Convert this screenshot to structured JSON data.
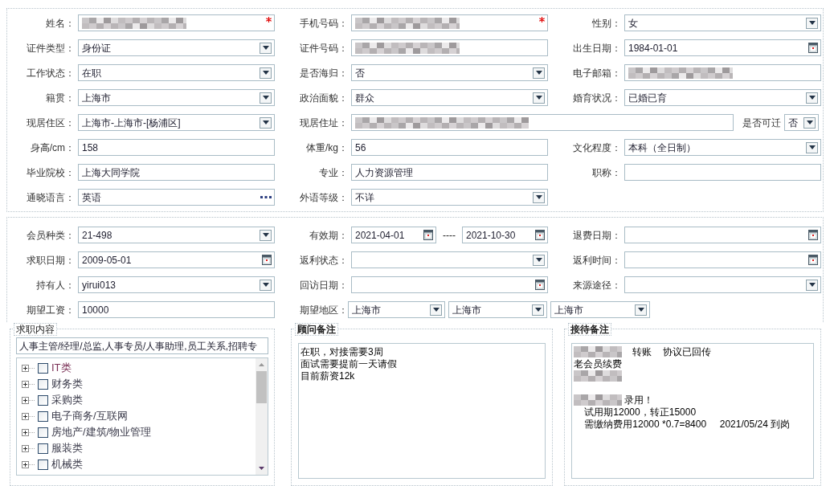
{
  "personal_section": {
    "rows": [
      [
        {
          "label": "姓名：",
          "field": {
            "kind": "text",
            "redacted": true,
            "required": true
          }
        },
        {
          "label": "手机号码：",
          "field": {
            "kind": "text",
            "redacted": true,
            "required": true
          }
        },
        {
          "label": "性别：",
          "field": {
            "kind": "select",
            "value": "女"
          }
        }
      ],
      [
        {
          "label": "证件类型：",
          "field": {
            "kind": "select",
            "value": "身份证"
          }
        },
        {
          "label": "证件号码：",
          "field": {
            "kind": "text",
            "redacted": true
          }
        },
        {
          "label": "出生日期：",
          "field": {
            "kind": "date",
            "value": "1984-01-01"
          }
        }
      ],
      [
        {
          "label": "工作状态：",
          "field": {
            "kind": "select",
            "value": "在职"
          }
        },
        {
          "label": "是否海归：",
          "field": {
            "kind": "select",
            "value": "否"
          }
        },
        {
          "label": "电子邮箱：",
          "field": {
            "kind": "text",
            "redacted": true
          }
        }
      ],
      [
        {
          "label": "籍贯：",
          "field": {
            "kind": "select",
            "value": "上海市"
          }
        },
        {
          "label": "政治面貌：",
          "field": {
            "kind": "select",
            "value": "群众"
          }
        },
        {
          "label": "婚育状况：",
          "field": {
            "kind": "select",
            "value": "已婚已育"
          }
        }
      ],
      [
        {
          "label": "现居住区：",
          "field": {
            "kind": "select",
            "value": "上海市-上海市-[杨浦区]"
          }
        },
        {
          "label": "现居住址：",
          "field": {
            "kind": "text",
            "redacted": true
          },
          "extra": {
            "label": "是否可迁",
            "field": {
              "kind": "select",
              "value": "否"
            }
          }
        }
      ],
      [
        {
          "label": "身高/cm：",
          "field": {
            "kind": "text",
            "value": "158"
          }
        },
        {
          "label": "体重/kg：",
          "field": {
            "kind": "text",
            "value": "56"
          }
        },
        {
          "label": "文化程度：",
          "field": {
            "kind": "select",
            "value": "本科（全日制）"
          }
        }
      ],
      [
        {
          "label": "毕业院校：",
          "field": {
            "kind": "text",
            "value": "上海大同学院"
          }
        },
        {
          "label": "专业：",
          "field": {
            "kind": "text",
            "value": "人力资源管理"
          }
        },
        {
          "label": "职称：",
          "field": {
            "kind": "text"
          }
        }
      ],
      [
        {
          "label": "通晓语言：",
          "field": {
            "kind": "lookup",
            "value": "英语"
          }
        },
        {
          "label": "外语等级：",
          "field": {
            "kind": "select",
            "value": "不详"
          }
        }
      ]
    ]
  },
  "membership_section": {
    "rows": [
      [
        {
          "label": "会员种类：",
          "field": {
            "kind": "select",
            "value": "21-498"
          }
        },
        {
          "label": "有效期：",
          "field": {
            "kind": "date_range",
            "values": [
              "2021-04-01",
              "2021-10-30"
            ],
            "separator": "----"
          }
        },
        {
          "label": "退费日期：",
          "field": {
            "kind": "date"
          }
        }
      ],
      [
        {
          "label": "求职日期：",
          "field": {
            "kind": "date",
            "value": "2009-05-01"
          }
        },
        {
          "label": "返利状态：",
          "field": {
            "kind": "select"
          }
        },
        {
          "label": "返利时间：",
          "field": {
            "kind": "date"
          }
        }
      ],
      [
        {
          "label": "持有人：",
          "field": {
            "kind": "select",
            "value": "yirui013"
          }
        },
        {
          "label": "回访日期：",
          "field": {
            "kind": "date"
          }
        },
        {
          "label": "来源途径：",
          "field": {
            "kind": "select"
          }
        }
      ],
      [
        {
          "label": "期望工资：",
          "field": {
            "kind": "text",
            "value": "10000"
          }
        },
        {
          "label": "期望地区：",
          "field": {
            "kind": "select_group",
            "values": [
              "上海市",
              "上海市",
              "上海市"
            ]
          }
        }
      ]
    ]
  },
  "job_content": {
    "title": "求职内容",
    "summary": "人事主管/经理/总监,人事专员/人事助理,员工关系,招聘专",
    "tree": [
      {
        "label": "IT类",
        "checked": false,
        "expanded": false,
        "highlighted": true
      },
      {
        "label": "财务类",
        "checked": false,
        "expanded": false,
        "highlighted": false
      },
      {
        "label": "采购类",
        "checked": false,
        "expanded": false,
        "highlighted": false
      },
      {
        "label": "电子商务/互联网",
        "checked": false,
        "expanded": false,
        "highlighted": false
      },
      {
        "label": "房地产/建筑/物业管理",
        "checked": false,
        "expanded": false,
        "highlighted": false
      },
      {
        "label": "服装类",
        "checked": false,
        "expanded": false,
        "highlighted": false
      },
      {
        "label": "机械类",
        "checked": false,
        "expanded": false,
        "highlighted": false
      }
    ]
  },
  "notes": [
    {
      "title": "顾问备注",
      "lines": [
        [
          {
            "kind": "text",
            "text": "在职，对接需要3周"
          }
        ],
        [
          {
            "kind": "text",
            "text": "面试需要提前一天请假"
          }
        ],
        [
          {
            "kind": "text",
            "text": "目前薪资12k"
          }
        ]
      ]
    },
    {
      "title": "接待备注",
      "lines": [
        [
          {
            "kind": "redacted"
          },
          {
            "kind": "text",
            "text": "    转账    协议已回传"
          }
        ],
        [
          {
            "kind": "text",
            "text": "老会员续费"
          }
        ],
        [
          {
            "kind": "redacted"
          }
        ],
        [
          {
            "kind": "redacted"
          },
          {
            "kind": "text",
            "text": " 录用！"
          }
        ],
        [
          {
            "kind": "text",
            "text": "    试用期12000，转正15000"
          }
        ],
        [
          {
            "kind": "text",
            "text": "    需缴纳费用12000 *0.7=8400     2021/05/24 到岗"
          }
        ]
      ]
    }
  ]
}
